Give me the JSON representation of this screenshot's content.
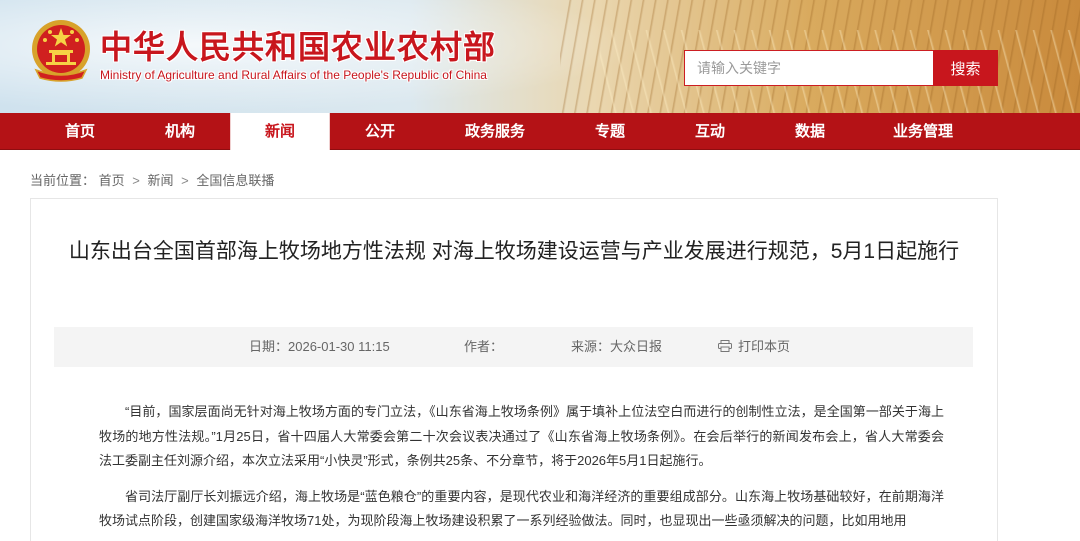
{
  "site": {
    "cn_title": "中华人民共和国农业农村部",
    "en_title": "Ministry of Agriculture and Rural Affairs of the People's Republic of China",
    "emblem_icon": "national-emblem-icon",
    "brand_color": "#c8161d"
  },
  "search": {
    "placeholder": "请输入关键字",
    "button_label": "搜索"
  },
  "nav": {
    "items": [
      {
        "label": "首页"
      },
      {
        "label": "机构"
      },
      {
        "label": "新闻",
        "active": true
      },
      {
        "label": "公开"
      },
      {
        "label": "政务服务"
      },
      {
        "label": "专题"
      },
      {
        "label": "互动"
      },
      {
        "label": "数据"
      },
      {
        "label": "业务管理"
      }
    ]
  },
  "breadcrumb": {
    "prefix": "当前位置：",
    "items": [
      "首页",
      "新闻",
      "全国信息联播"
    ],
    "separator": ">"
  },
  "article": {
    "title": "山东出台全国首部海上牧场地方性法规 对海上牧场建设运营与产业发展进行规范，5月1日起施行",
    "meta": {
      "date_label": "日期：",
      "date": "2026-01-30 11:15",
      "author_label": "作者：",
      "author": "",
      "source_label": "来源：",
      "source": "大众日报",
      "print_label": "打印本页",
      "print_icon": "printer-icon"
    },
    "paragraphs": [
      "“目前，国家层面尚无针对海上牧场方面的专门立法，《山东省海上牧场条例》属于填补上位法空白而进行的创制性立法，是全国第一部关于海上牧场的地方性法规。”1月25日，省十四届人大常委会第二十次会议表决通过了《山东省海上牧场条例》。在会后举行的新闻发布会上，省人大常委会法工委副主任刘源介绍，本次立法采用“小快灵”形式，条例共25条、不分章节，将于2026年5月1日起施行。",
      "省司法厅副厅长刘振远介绍，海上牧场是“蓝色粮仓”的重要内容，是现代农业和海洋经济的重要组成部分。山东海上牧场基础较好，在前期海洋牧场试点阶段，创建国家级海洋牧场71处，为现阶段海上牧场建设积累了一系列经验做法。同时，也显现出一些亟须解决的问题，比如用地用"
    ]
  }
}
